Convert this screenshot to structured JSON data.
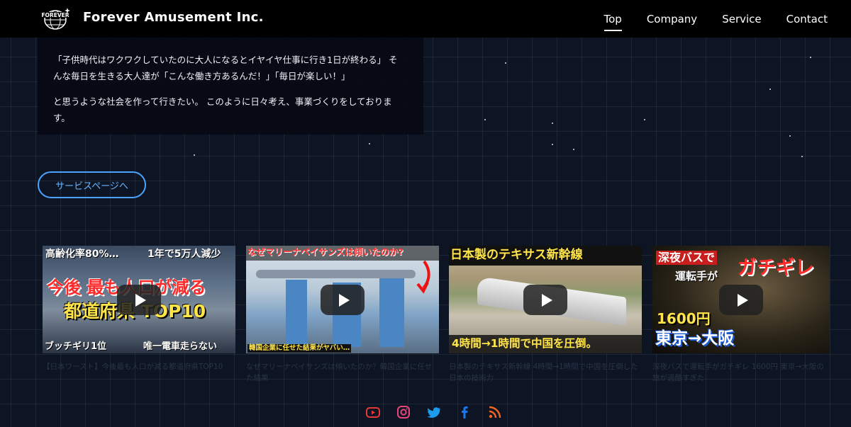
{
  "header": {
    "logo_text": "FOREVER",
    "brand": "Forever Amusement Inc.",
    "nav": [
      {
        "label": "Top",
        "active": true
      },
      {
        "label": "Company",
        "active": false
      },
      {
        "label": "Service",
        "active": false
      },
      {
        "label": "Contact",
        "active": false
      }
    ]
  },
  "intro": {
    "paragraph1": "「子供時代はワクワクしていたのに大人になるとイヤイヤ仕事に行き1日が終わる」 そんな毎日を生きる大人達が「こんな働き方あるんだ！」「毎日が楽しい！」",
    "paragraph2": "と思うような社会を作って行きたい。 このように日々考え、事業づくりをしております。"
  },
  "service_button": "サービスページへ",
  "videos": [
    {
      "texts": {
        "t1": "高齢化率80%…",
        "t2": "1年で5万人減少",
        "t3": "今後 最も人口が減る",
        "t4": "都道府県 TOP10",
        "t5": "ブッチギリ1位",
        "t6": "唯一電車走らない"
      },
      "caption": "【日本ワースト】今後最も人口が減る都道府県TOP10"
    },
    {
      "texts": {
        "t1": "なぜマリーナベイサンズは傾いたのか?",
        "t2": "韓国企業に任せた結果がヤバい…"
      },
      "caption": "なぜマリーナベイサンズは傾いたのか？韓国企業に任せた結果"
    },
    {
      "texts": {
        "t1": "日本製のテキサス新幹線",
        "t2": "4時間→1時間で中国を圧倒。"
      },
      "caption": "日本製のテキサス新幹線 4時間→1時間で中国を圧倒した日本の技術力"
    },
    {
      "texts": {
        "t1": "深夜バスで",
        "t2": "運転手が",
        "t3": "ガチギレ",
        "t4": "1600円",
        "t5": "東京→大阪"
      },
      "caption": "深夜バスで運転手がガチギレ 1600円 東京→大阪の旅が過酷すぎた"
    }
  ],
  "social": [
    "youtube-icon",
    "instagram-icon",
    "twitter-icon",
    "facebook-icon",
    "rss-icon"
  ],
  "colors": {
    "accent": "#4aa3ff",
    "header_bg": "#000000",
    "page_bg": "#0d1524"
  }
}
